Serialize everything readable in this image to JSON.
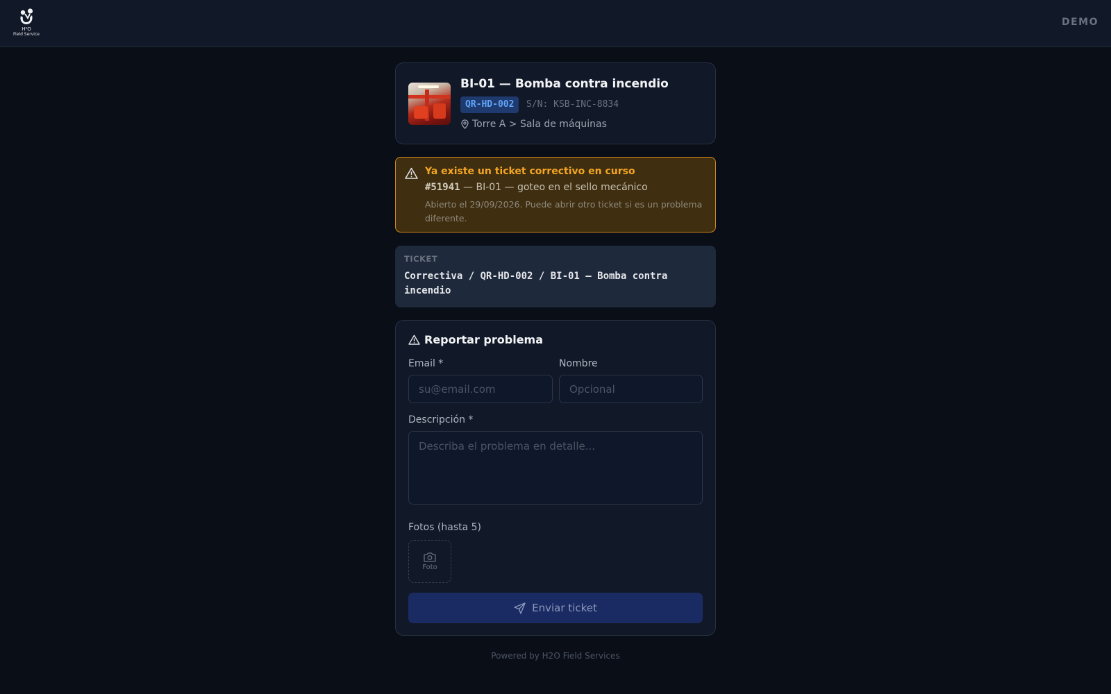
{
  "header": {
    "logo_text_1": "H²O",
    "logo_text_2": "Field Service",
    "mode_label": "DEMO"
  },
  "asset": {
    "title": "BI-01 — Bomba contra incendio",
    "qr_code": "QR-HD-002",
    "serial": "S/N: KSB-INC-8834",
    "location": "Torre A > Sala de máquinas"
  },
  "warning": {
    "title": "Ya existe un ticket correctivo en curso",
    "ticket_number": "#51941",
    "ticket_summary": " — BI-01 — goteo en el sello mecánico",
    "note": "Abierto el 29/09/2026. Puede abrir otro ticket si es un problema diferente."
  },
  "ticket": {
    "label": "TICKET",
    "path": "Correctiva / QR-HD-002 / BI-01 — Bomba contra incendio"
  },
  "form": {
    "title": "Reportar problema",
    "email_label": "Email *",
    "email_placeholder": "su@email.com",
    "name_label": "Nombre",
    "name_placeholder": "Opcional",
    "description_label": "Descripción *",
    "description_placeholder": "Describa el problema en detalle...",
    "photos_label": "Fotos (hasta 5)",
    "photo_button_label": "Foto",
    "submit_label": "Enviar ticket"
  },
  "footer": {
    "text": "Powered by H2O Field Services"
  },
  "colors": {
    "background": "#0a0e17",
    "card": "#111827",
    "accent_blue": "#60a5fa",
    "warning_orange": "#f5a623",
    "submit_bg": "#1a2b63"
  },
  "icons": {
    "logo": "h2o-logo-icon",
    "location": "map-pin-icon",
    "warning": "alert-triangle-icon",
    "photo": "camera-icon",
    "submit": "send-icon"
  }
}
